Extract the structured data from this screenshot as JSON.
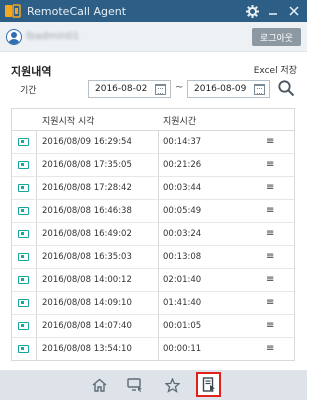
{
  "app": {
    "title": "RemoteCall Agent"
  },
  "user": {
    "name": "lbadmin01",
    "logout_label": "로그아웃"
  },
  "history": {
    "title": "지원내역",
    "excel_label": "Excel 저장",
    "period_label": "기간",
    "start_date": "2016-08-02",
    "end_date": "2016-08-09",
    "separator": "~",
    "columns": [
      "지원시작 시각",
      "지원시간"
    ],
    "rows": [
      {
        "start": "2016/08/09 16:29:54",
        "duration": "00:14:37"
      },
      {
        "start": "2016/08/08 17:35:05",
        "duration": "00:21:26"
      },
      {
        "start": "2016/08/08 17:28:42",
        "duration": "00:03:44"
      },
      {
        "start": "2016/08/08 16:46:38",
        "duration": "00:05:49"
      },
      {
        "start": "2016/08/08 16:49:02",
        "duration": "00:03:24"
      },
      {
        "start": "2016/08/08 16:35:03",
        "duration": "00:13:08"
      },
      {
        "start": "2016/08/08 14:00:12",
        "duration": "02:01:40"
      },
      {
        "start": "2016/08/08 14:09:10",
        "duration": "01:41:40"
      },
      {
        "start": "2016/08/08 14:07:40",
        "duration": "00:01:05"
      },
      {
        "start": "2016/08/08 13:54:10",
        "duration": "00:00:11"
      }
    ]
  },
  "nav": {
    "icons": [
      "home-icon",
      "remote-session-icon",
      "favorite-star-icon",
      "history-report-icon"
    ],
    "active": "history-report-icon"
  },
  "colors": {
    "titlebar": "#2d5f86",
    "accent_teal": "#17a89b",
    "active_border": "#e0231a"
  }
}
